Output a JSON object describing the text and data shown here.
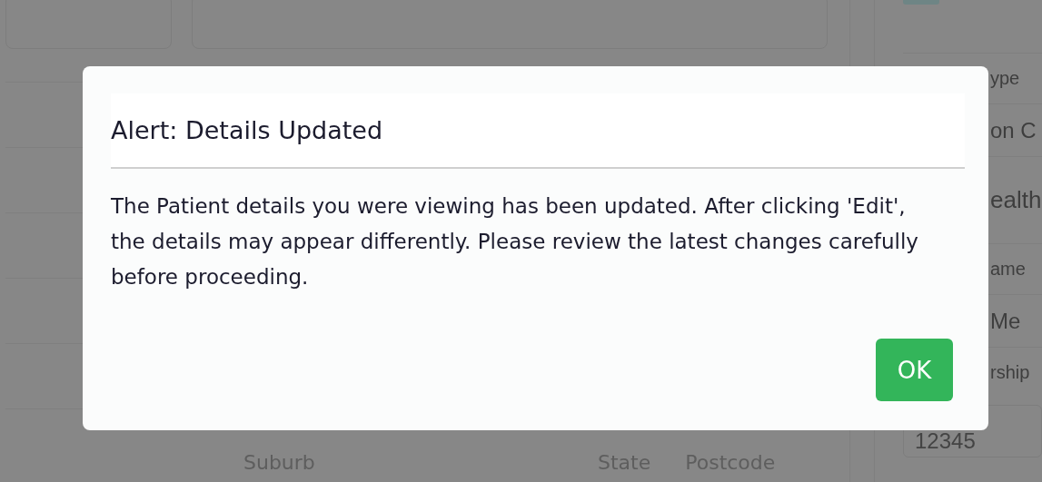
{
  "background_form": {
    "right_panel": [
      {
        "kind": "label",
        "text": "ype"
      },
      {
        "kind": "value",
        "text": "on C"
      },
      {
        "kind": "tall",
        "text": "ealth"
      },
      {
        "kind": "label",
        "text": "ame"
      },
      {
        "kind": "value",
        "text": "Me"
      },
      {
        "kind": "label",
        "text": "rship"
      },
      {
        "kind": "input",
        "text": "12345"
      }
    ],
    "bottom_labels": [
      {
        "text": "Suburb",
        "kind": "wide"
      },
      {
        "text": "State",
        "kind": "narrow"
      },
      {
        "text": "Postcode",
        "kind": "narrow"
      }
    ]
  },
  "dialog": {
    "title": "Alert: Details Updated",
    "message": "The Patient details you were viewing has been updated. After clicking 'Edit', the details may appear differently. Please review the latest changes carefully before proceeding.",
    "buttons": [
      {
        "label": "OK"
      }
    ]
  }
}
